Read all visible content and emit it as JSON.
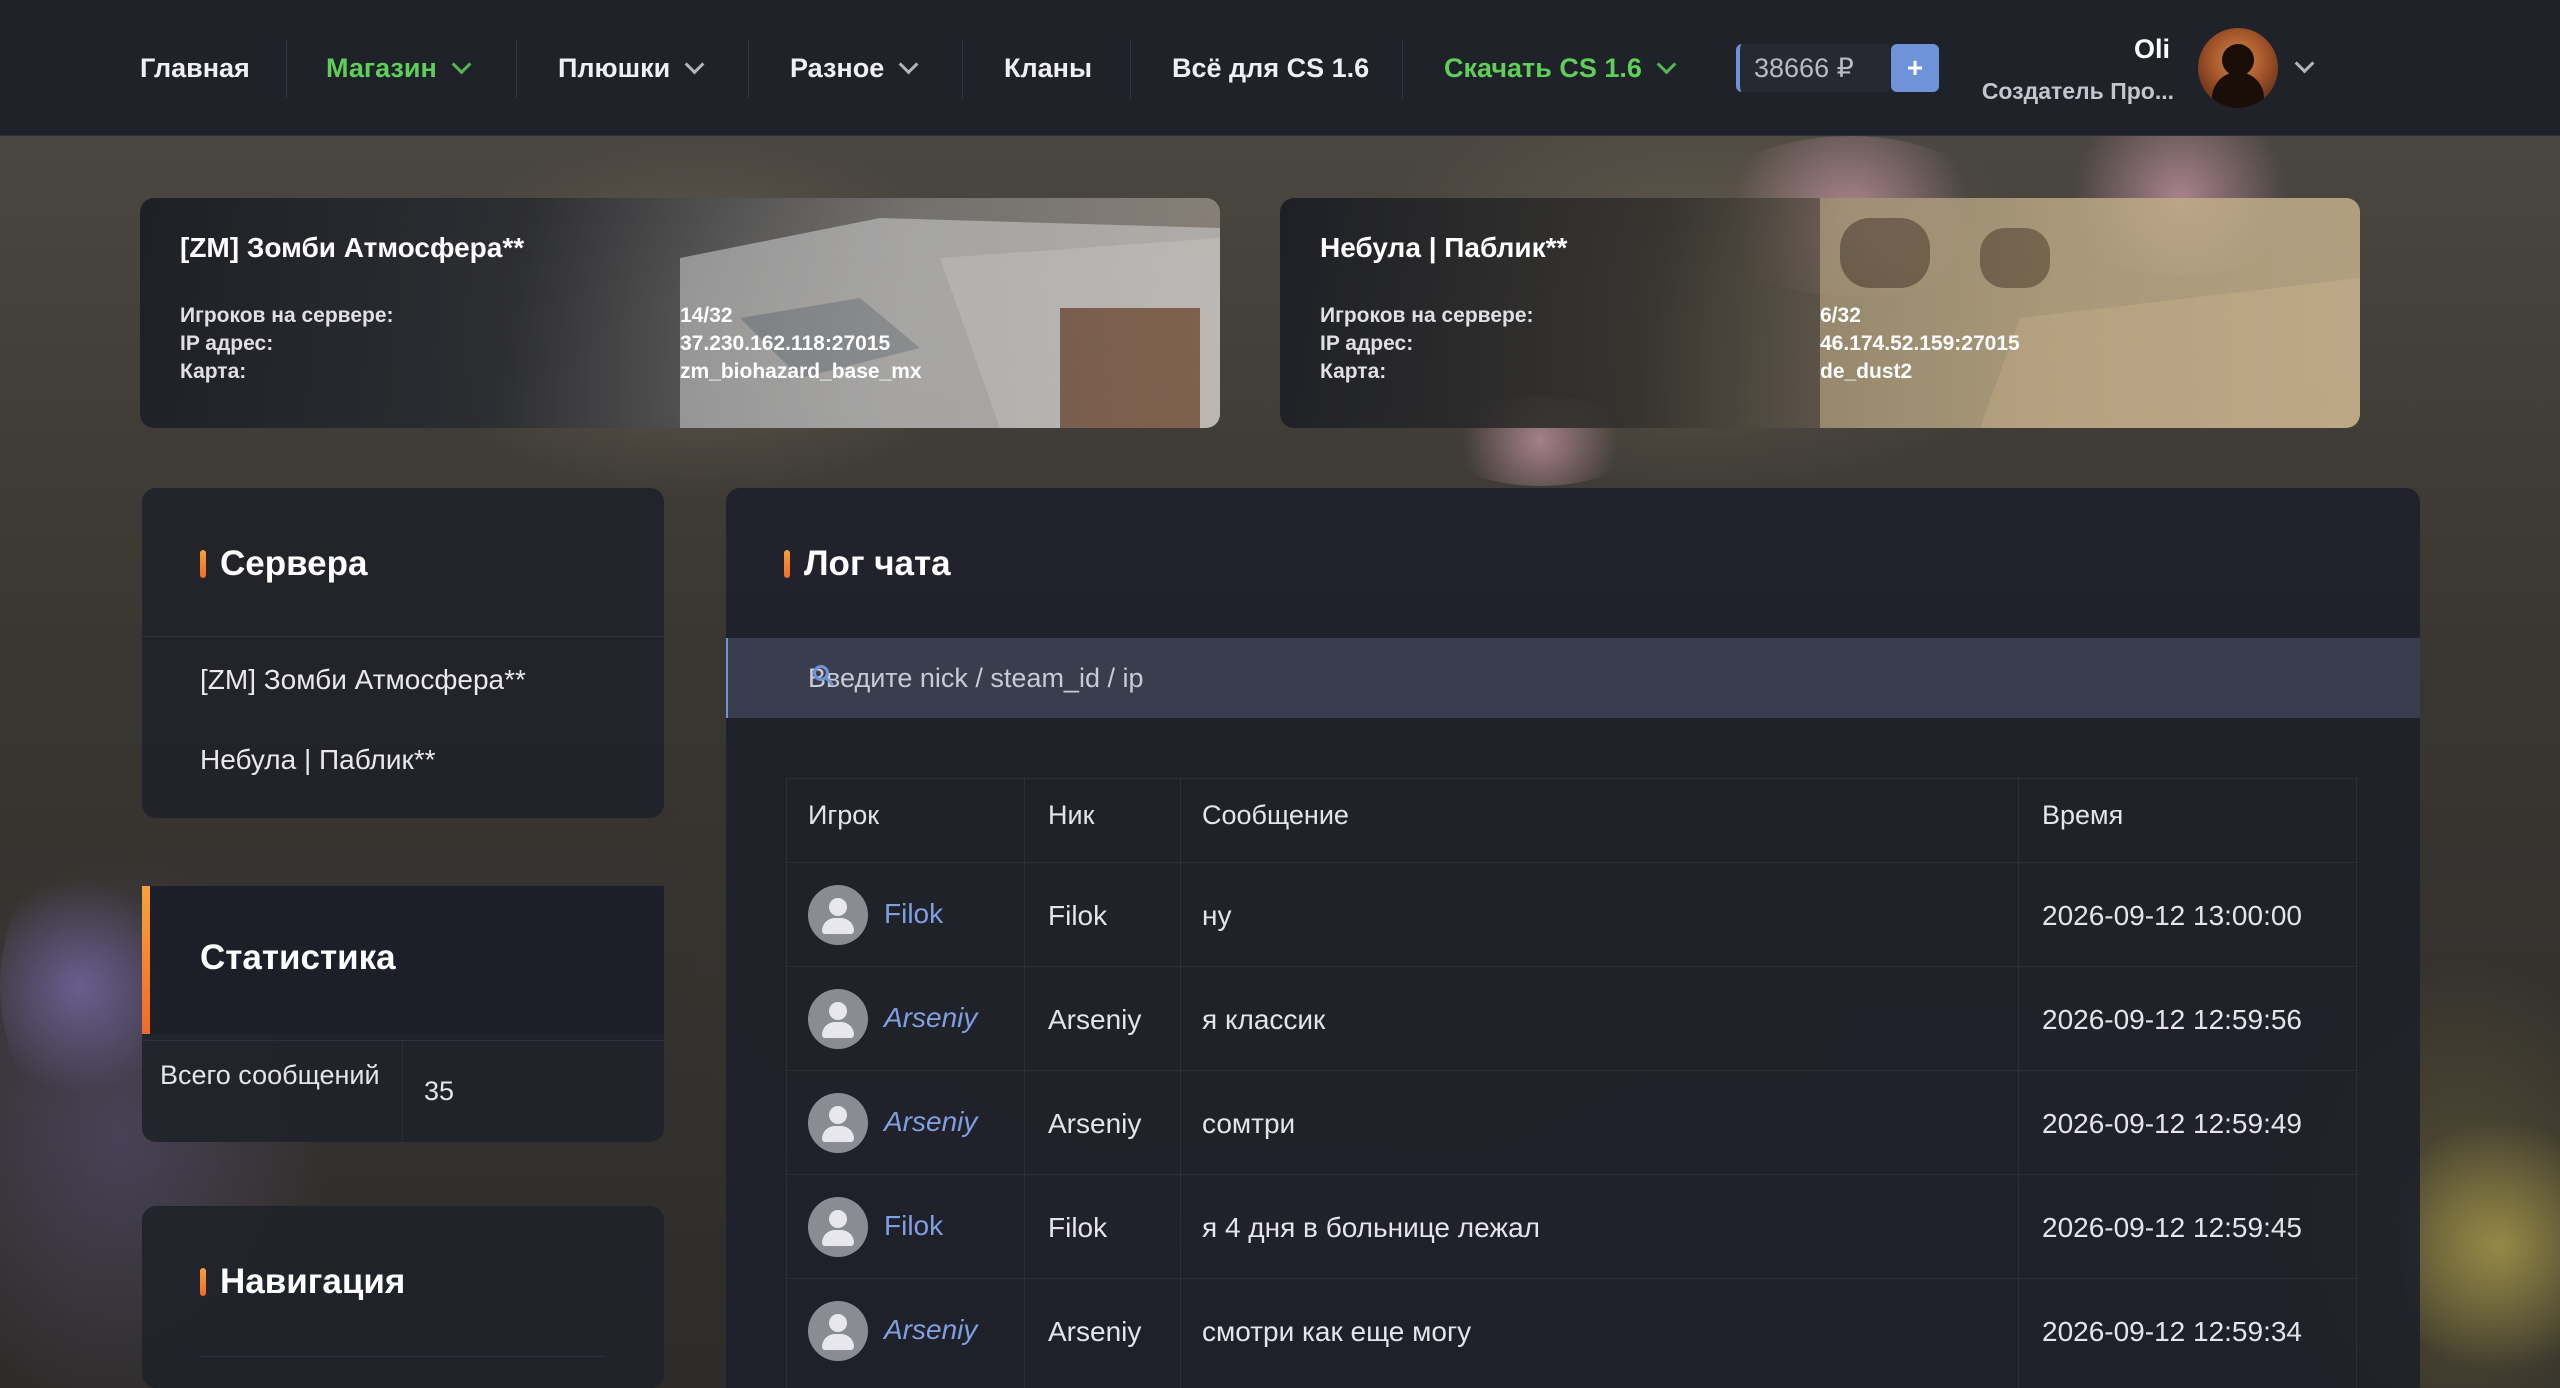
{
  "nav": {
    "items": [
      {
        "label": "Главная"
      },
      {
        "label": "Магазин"
      },
      {
        "label": "Плюшки"
      },
      {
        "label": "Разное"
      },
      {
        "label": "Кланы"
      },
      {
        "label": "Всё для CS 1.6"
      },
      {
        "label": "Скачать CS 1.6"
      }
    ],
    "balance": "38666 ₽",
    "add_funds": "+",
    "user_name": "Oli",
    "user_role": "Создатель Про..."
  },
  "servers": [
    {
      "name": "[ZM] Зомби Атмосфера**",
      "players_label": "Игроков на сервере:",
      "players": "14/32",
      "ip_label": "IP адрес:",
      "ip": "37.230.162.118:27015",
      "map_label": "Карта:",
      "map": "zm_biohazard_base_mx"
    },
    {
      "name": "Небула | Паблик**",
      "players_label": "Игроков на сервере:",
      "players": "6/32",
      "ip_label": "IP адрес:",
      "ip": "46.174.52.159:27015",
      "map_label": "Карта:",
      "map": "de_dust2"
    }
  ],
  "sidebar": {
    "servers_title": "Сервера",
    "server_links": [
      "[ZM] Зомби Атмосфера**",
      "Небула | Паблик**"
    ],
    "stats_title": "Статистика",
    "stats_label": "Всего сообщений",
    "stats_value": "35",
    "nav_title": "Навигация"
  },
  "chat": {
    "title": "Лог чата",
    "search_placeholder": "Введите nick / steam_id / ip",
    "columns": [
      "Игрок",
      "Ник",
      "Сообщение",
      "Время"
    ],
    "rows": [
      {
        "player": "Filok",
        "nick": "Filok",
        "message": "ну",
        "time": "2026-09-12 13:00:00",
        "style": "normal"
      },
      {
        "player": "Arseniy",
        "nick": "Arseniy",
        "message": "я классик",
        "time": "2026-09-12 12:59:56",
        "style": "italic"
      },
      {
        "player": "Arseniy",
        "nick": "Arseniy",
        "message": "сомтри",
        "time": "2026-09-12 12:59:49",
        "style": "italic"
      },
      {
        "player": "Filok",
        "nick": "Filok",
        "message": "я 4 дня в больнице лежал",
        "time": "2026-09-12 12:59:45",
        "style": "normal"
      },
      {
        "player": "Arseniy",
        "nick": "Arseniy",
        "message": "смотри как еще могу",
        "time": "2026-09-12 12:59:34",
        "style": "italic"
      }
    ]
  },
  "colors": {
    "accent_green": "#5fcf5a",
    "accent_blue": "#6f93d8",
    "accent_orange": "#f7a23a"
  }
}
